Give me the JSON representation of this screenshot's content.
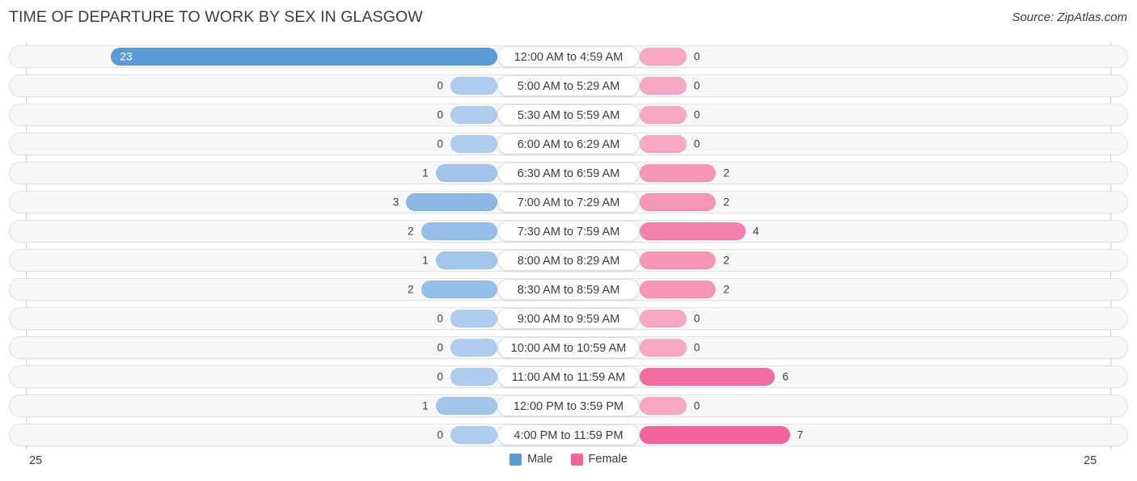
{
  "header": {
    "title": "TIME OF DEPARTURE TO WORK BY SEX IN GLASGOW",
    "source": "Source: ZipAtlas.com"
  },
  "colors": {
    "male_strong": "#5B9BD5",
    "male_light": "#AECDEE",
    "female_strong": "#F2649A",
    "female_light": "#F7A8C4",
    "row_bg": "#f7f7f7",
    "row_border": "#e3e3e3",
    "text": "#3c3c3c"
  },
  "axis": {
    "left_end_label": "25",
    "right_end_label": "25",
    "max": 25
  },
  "legend": [
    {
      "label": "Male",
      "color": "#5B9BD5",
      "name": "male"
    },
    {
      "label": "Female",
      "color": "#F2649A",
      "name": "female"
    }
  ],
  "chart_data": {
    "type": "bar",
    "title": "TIME OF DEPARTURE TO WORK BY SEX IN GLASGOW",
    "subtitle": "Source: ZipAtlas.com",
    "orientation": "horizontal-diverging",
    "xlabel": "",
    "ylabel": "",
    "xlim": [
      25,
      25
    ],
    "grid": false,
    "legend_position": "bottom-center",
    "categories": [
      "12:00 AM to 4:59 AM",
      "5:00 AM to 5:29 AM",
      "5:30 AM to 5:59 AM",
      "6:00 AM to 6:29 AM",
      "6:30 AM to 6:59 AM",
      "7:00 AM to 7:29 AM",
      "7:30 AM to 7:59 AM",
      "8:00 AM to 8:29 AM",
      "8:30 AM to 8:59 AM",
      "9:00 AM to 9:59 AM",
      "10:00 AM to 10:59 AM",
      "11:00 AM to 11:59 AM",
      "12:00 PM to 3:59 PM",
      "4:00 PM to 11:59 PM"
    ],
    "series": [
      {
        "name": "Male",
        "values": [
          23,
          0,
          0,
          0,
          1,
          3,
          2,
          1,
          2,
          0,
          0,
          0,
          1,
          0
        ]
      },
      {
        "name": "Female",
        "values": [
          0,
          0,
          0,
          0,
          2,
          2,
          4,
          2,
          2,
          0,
          0,
          6,
          0,
          7
        ]
      }
    ]
  },
  "rows": [
    {
      "category": "12:00 AM to 4:59 AM",
      "male": "23",
      "female": "0"
    },
    {
      "category": "5:00 AM to 5:29 AM",
      "male": "0",
      "female": "0"
    },
    {
      "category": "5:30 AM to 5:59 AM",
      "male": "0",
      "female": "0"
    },
    {
      "category": "6:00 AM to 6:29 AM",
      "male": "0",
      "female": "0"
    },
    {
      "category": "6:30 AM to 6:59 AM",
      "male": "1",
      "female": "2"
    },
    {
      "category": "7:00 AM to 7:29 AM",
      "male": "3",
      "female": "2"
    },
    {
      "category": "7:30 AM to 7:59 AM",
      "male": "2",
      "female": "4"
    },
    {
      "category": "8:00 AM to 8:29 AM",
      "male": "1",
      "female": "2"
    },
    {
      "category": "8:30 AM to 8:59 AM",
      "male": "2",
      "female": "2"
    },
    {
      "category": "9:00 AM to 9:59 AM",
      "male": "0",
      "female": "0"
    },
    {
      "category": "10:00 AM to 10:59 AM",
      "male": "0",
      "female": "0"
    },
    {
      "category": "11:00 AM to 11:59 AM",
      "male": "0",
      "female": "6"
    },
    {
      "category": "12:00 PM to 3:59 PM",
      "male": "1",
      "female": "0"
    },
    {
      "category": "4:00 PM to 11:59 PM",
      "male": "0",
      "female": "7"
    }
  ]
}
